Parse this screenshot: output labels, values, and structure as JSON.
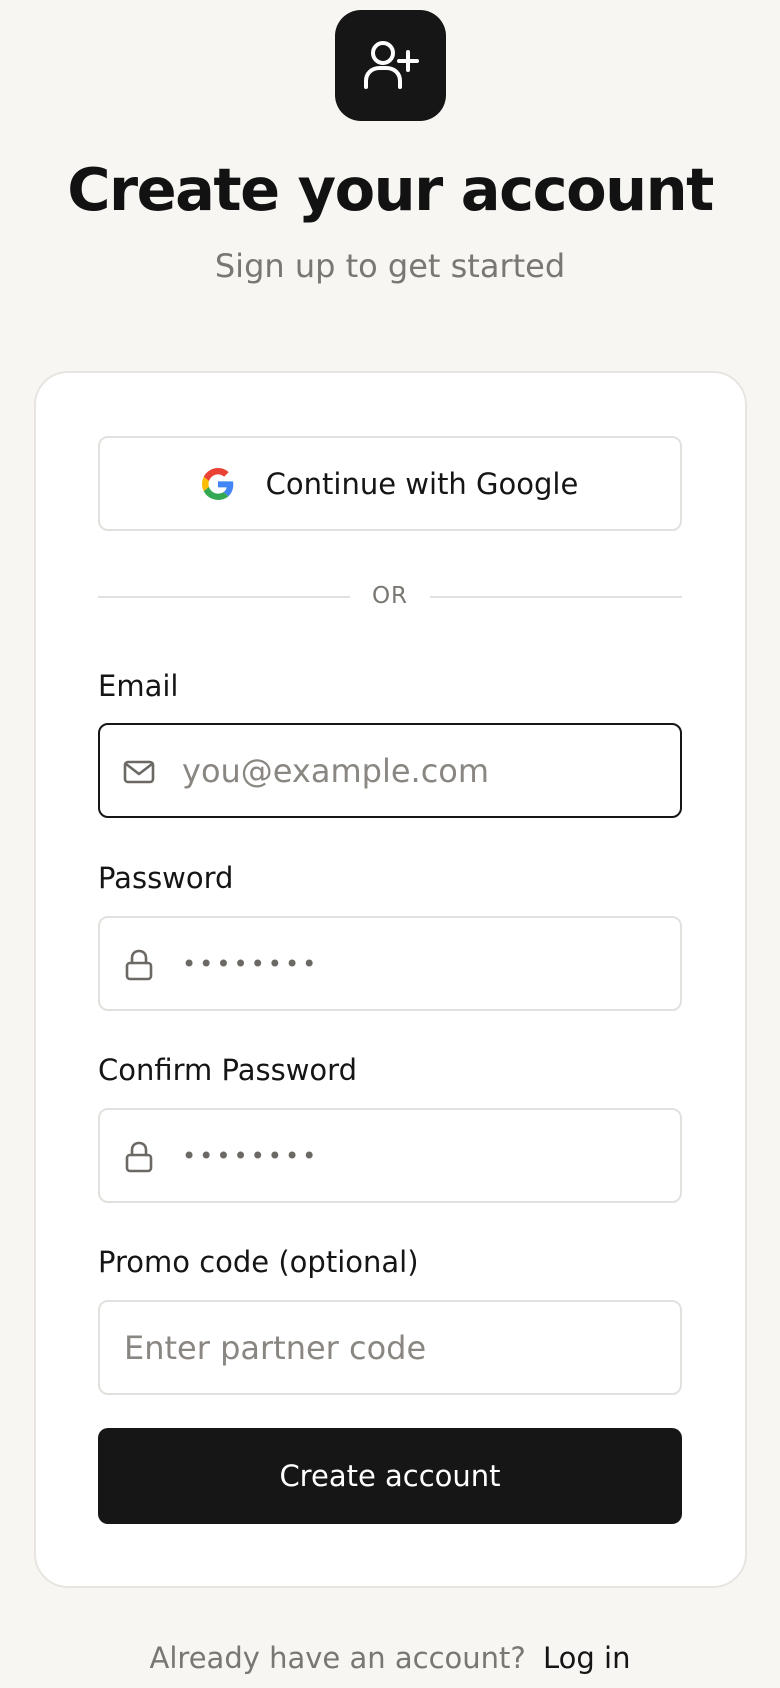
{
  "header": {
    "icon": "user-plus-icon",
    "title": "Create your account",
    "subtitle": "Sign up to get started"
  },
  "form": {
    "google_button": {
      "label": "Continue with Google",
      "icon": "google-icon"
    },
    "divider": "OR",
    "email": {
      "label": "Email",
      "placeholder": "you@example.com",
      "icon": "mail-icon"
    },
    "password": {
      "label": "Password",
      "value": "••••••••",
      "icon": "lock-icon"
    },
    "confirm_password": {
      "label": "Confirm Password",
      "value": "••••••••",
      "icon": "lock-icon"
    },
    "promo": {
      "label": "Promo code (optional)",
      "placeholder": "Enter partner code"
    },
    "submit_label": "Create account"
  },
  "footer": {
    "prompt": "Already have an account?",
    "link": "Log in"
  },
  "colors": {
    "background": "#f8f6f2",
    "primary": "#161616",
    "muted_text": "#7a7772",
    "border": "#e3e1dd"
  }
}
